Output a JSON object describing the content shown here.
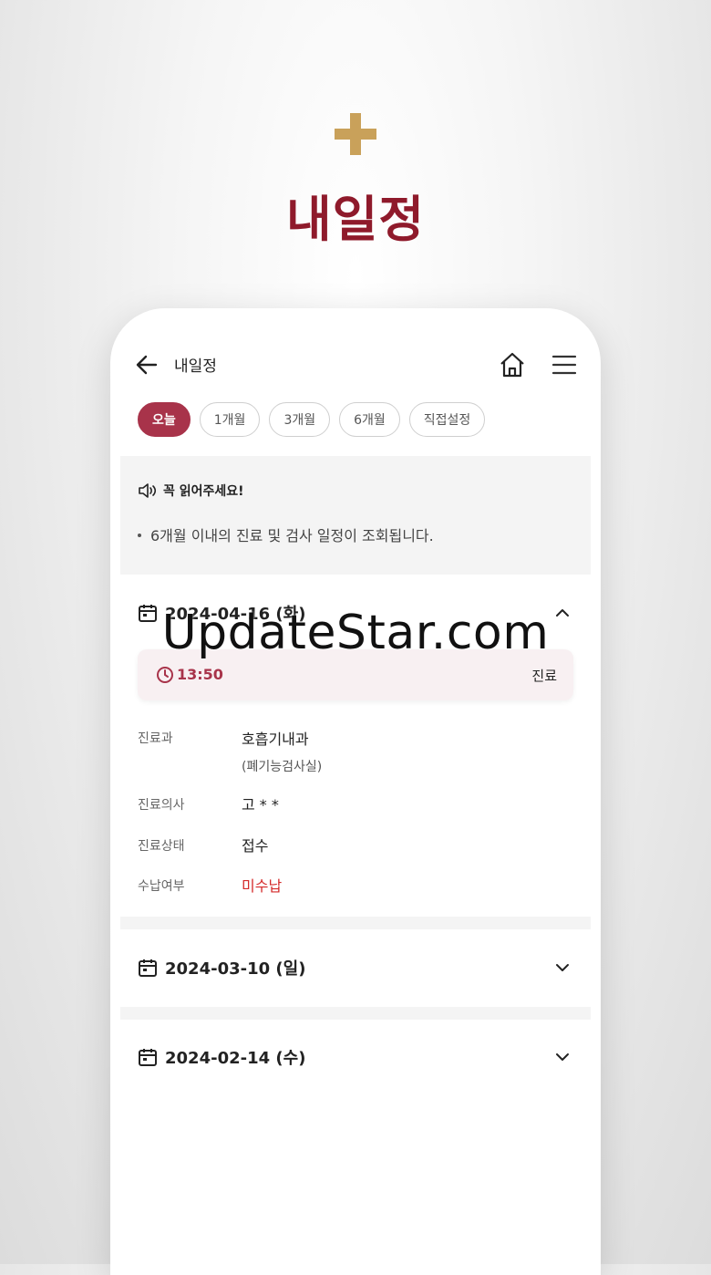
{
  "hero": {
    "title": "내일정"
  },
  "header": {
    "title": "내일정"
  },
  "filters": [
    "오늘",
    "1개월",
    "3개월",
    "6개월",
    "직접설정"
  ],
  "notice": {
    "title": "꼭 읽어주세요!",
    "text": "6개월 이내의 진료 및 검사 일정이 조회됩니다."
  },
  "appointments": [
    {
      "date": "2024-04-16 (화)",
      "expanded": true,
      "time": "13:50",
      "type": "진료",
      "details": {
        "dept_label": "진료과",
        "dept_value": "호흡기내과",
        "dept_sub": "(폐기능검사실)",
        "doctor_label": "진료의사",
        "doctor_value": "고 * *",
        "status_label": "진료상태",
        "status_value": "접수",
        "payment_label": "수납여부",
        "payment_value": "미수납"
      }
    },
    {
      "date": "2024-03-10 (일)",
      "expanded": false
    },
    {
      "date": "2024-02-14 (수)",
      "expanded": false
    }
  ],
  "watermark": "UpdateStar.com",
  "colors": {
    "accent": "#a8334a",
    "gold": "#c9a15a",
    "hero_red": "#8f1a2b",
    "unpaid": "#d42a2a"
  }
}
